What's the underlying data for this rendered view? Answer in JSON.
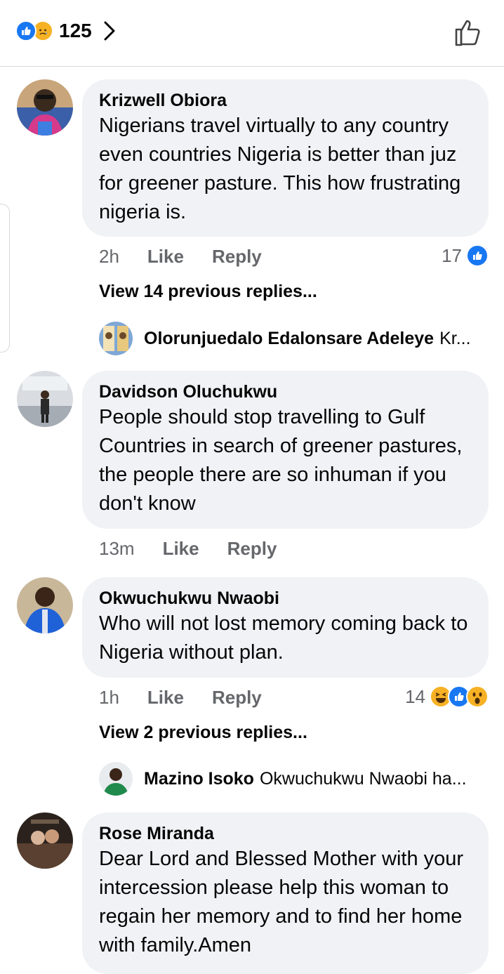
{
  "header": {
    "reaction_count": "125",
    "reaction_icons": [
      "like-icon",
      "sad-icon"
    ]
  },
  "comments": [
    {
      "author": "Krizwell Obiora",
      "text": "Nigerians travel virtually to any country even countries Nigeria is better than juz for greener pasture. This how frustrating nigeria is.",
      "time": "2h",
      "like_label": "Like",
      "reply_label": "Reply",
      "reaction_count": "17",
      "view_replies": "View 14 previous replies...",
      "latest_reply": {
        "author": "Olorunjuedalo Edalonsare Adeleye",
        "snippet": "Kr..."
      }
    },
    {
      "author": "Davidson Oluchukwu",
      "text": "People should stop travelling to Gulf Countries in search of greener pastures, the people there are so inhuman if you don't know",
      "time": "13m",
      "like_label": "Like",
      "reply_label": "Reply"
    },
    {
      "author": "Okwuchukwu Nwaobi",
      "text": "Who will not lost memory coming back to Nigeria without plan.",
      "time": "1h",
      "like_label": "Like",
      "reply_label": "Reply",
      "reaction_count": "14",
      "view_replies": "View 2 previous replies...",
      "latest_reply": {
        "author": "Mazino Isoko",
        "snippet": "Okwuchukwu Nwaobi ha..."
      }
    },
    {
      "author": "Rose Miranda",
      "text": "Dear Lord and Blessed Mother with your intercession please help this woman to regain her memory and to find her home with family.Amen"
    }
  ],
  "colors": {
    "like_blue": "#1877f2",
    "bubble_bg": "#f0f2f5",
    "meta_gray": "#65676b",
    "reaction_yellow": "#f7b125"
  }
}
